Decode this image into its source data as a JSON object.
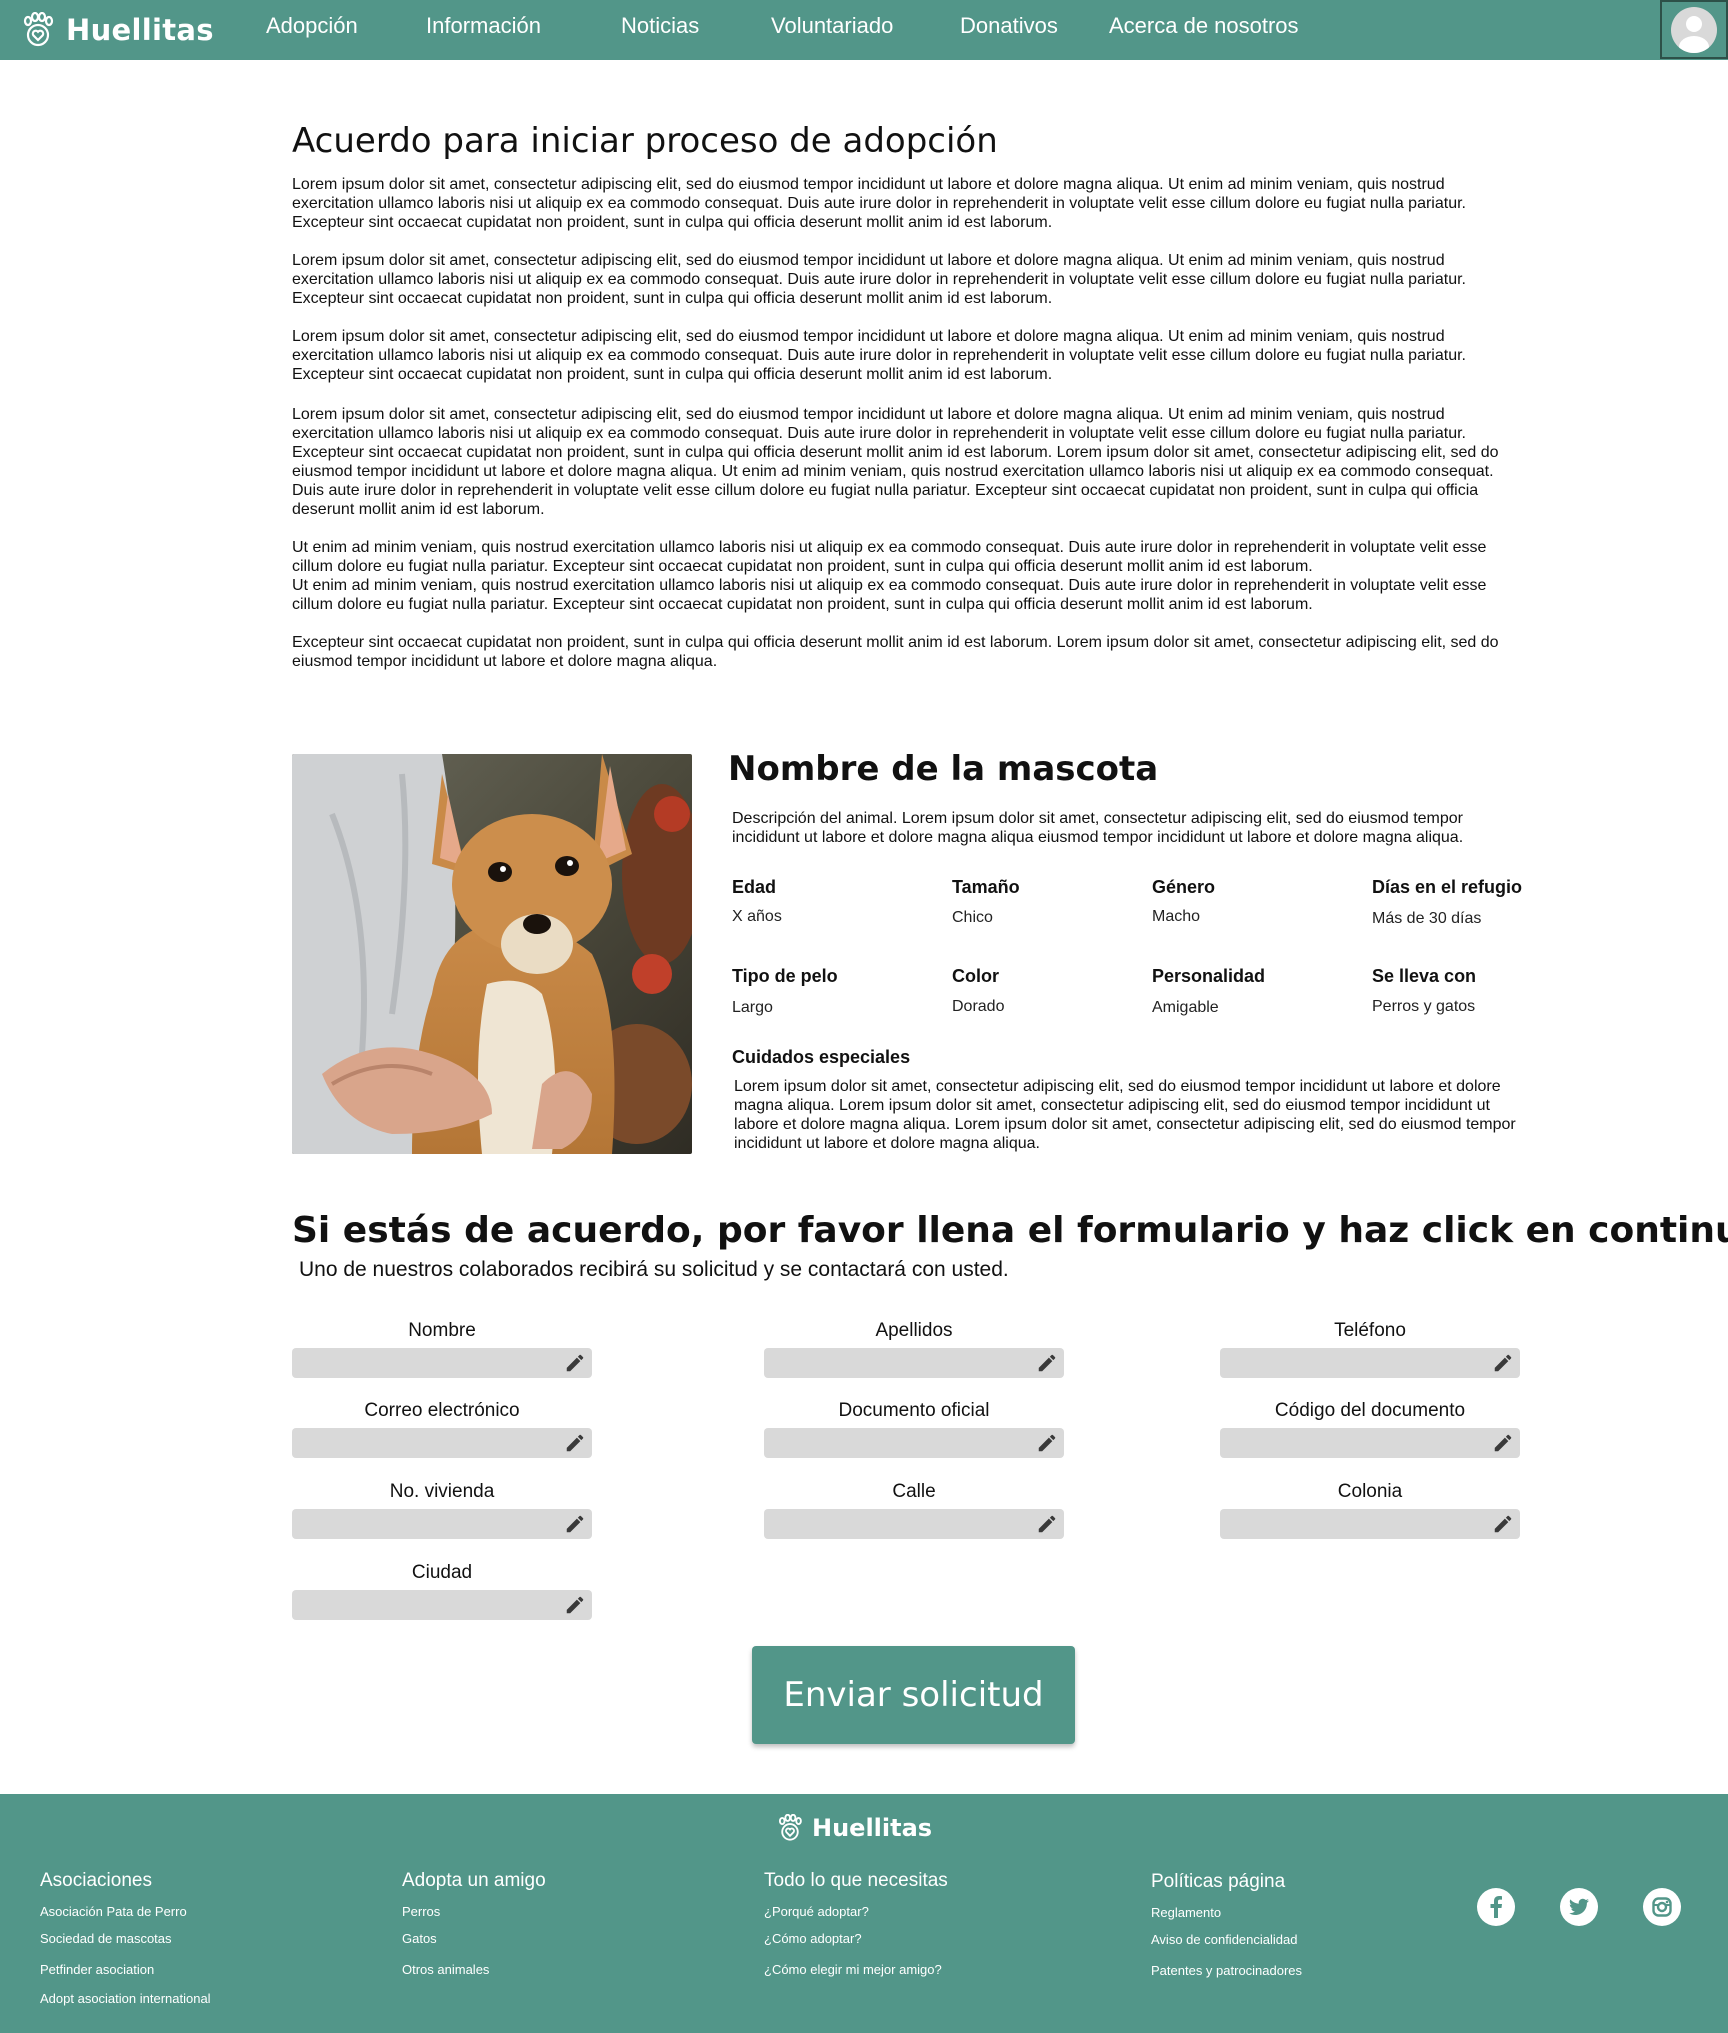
{
  "brand": {
    "name": "Huellitas"
  },
  "nav": {
    "links": [
      "Adopción",
      "Información",
      "Noticias",
      "Voluntariado",
      "Donativos",
      "Acerca de nosotros"
    ]
  },
  "agreement": {
    "title": "Acuerdo para iniciar proceso de adopción",
    "paragraphs": [
      "Lorem ipsum dolor sit amet, consectetur adipiscing elit, sed do eiusmod tempor incididunt ut labore et dolore magna aliqua. Ut enim ad minim veniam, quis nostrud exercitation ullamco laboris nisi ut aliquip ex ea commodo consequat. Duis aute irure dolor in reprehenderit in voluptate velit esse cillum dolore eu fugiat nulla pariatur. Excepteur sint occaecat cupidatat non proident, sunt in culpa qui officia deserunt mollit anim id est laborum.",
      "Lorem ipsum dolor sit amet, consectetur adipiscing elit, sed do eiusmod tempor incididunt ut labore et dolore magna aliqua. Ut enim ad minim veniam, quis nostrud exercitation ullamco laboris nisi ut aliquip ex ea commodo consequat. Duis aute irure dolor in reprehenderit in voluptate velit esse cillum dolore eu fugiat nulla pariatur. Excepteur sint occaecat cupidatat non proident, sunt in culpa qui officia deserunt mollit anim id est laborum.",
      "Lorem ipsum dolor sit amet, consectetur adipiscing elit, sed do eiusmod tempor incididunt ut labore et dolore magna aliqua. Ut enim ad minim veniam, quis nostrud exercitation ullamco laboris nisi ut aliquip ex ea commodo consequat. Duis aute irure dolor in reprehenderit in voluptate velit esse cillum dolore eu fugiat nulla pariatur. Excepteur sint occaecat cupidatat non proident, sunt in culpa qui officia deserunt mollit anim id est laborum.",
      "Lorem ipsum dolor sit amet, consectetur adipiscing elit, sed do eiusmod tempor incididunt ut labore et dolore magna aliqua. Ut enim ad minim veniam, quis nostrud exercitation ullamco laboris nisi ut aliquip ex ea commodo consequat. Duis aute irure dolor in reprehenderit in voluptate velit esse cillum dolore eu fugiat nulla pariatur. Excepteur sint occaecat cupidatat non proident, sunt in culpa qui officia deserunt mollit anim id est laborum. Lorem ipsum dolor sit amet, consectetur adipiscing elit, sed do eiusmod tempor incididunt ut labore et dolore magna aliqua. Ut enim ad minim veniam, quis nostrud exercitation ullamco laboris nisi ut aliquip ex ea commodo consequat. Duis aute irure dolor in reprehenderit in voluptate velit esse cillum dolore eu fugiat nulla pariatur. Excepteur sint occaecat cupidatat non proident, sunt in culpa qui officia deserunt mollit anim id est laborum.",
      "Ut enim ad minim veniam, quis nostrud exercitation ullamco laboris nisi ut aliquip ex ea commodo consequat. Duis aute irure dolor in reprehenderit in voluptate velit esse cillum dolore eu fugiat nulla pariatur. Excepteur sint occaecat cupidatat non proident, sunt in culpa qui officia deserunt mollit anim id est laborum.",
      "Ut enim ad minim veniam, quis nostrud exercitation ullamco laboris nisi ut aliquip ex ea commodo consequat. Duis aute irure dolor in reprehenderit in voluptate velit esse cillum dolore eu fugiat nulla pariatur. Excepteur sint occaecat cupidatat non proident, sunt in culpa qui officia deserunt mollit anim id est laborum.",
      "Excepteur sint occaecat cupidatat non proident, sunt in culpa qui officia deserunt mollit anim id est laborum. Lorem ipsum dolor sit amet, consectetur adipiscing elit, sed do eiusmod tempor incididunt ut labore et dolore magna aliqua."
    ]
  },
  "pet": {
    "name": "Nombre de la mascota",
    "description": "Descripción del animal. Lorem ipsum dolor sit amet, consectetur adipiscing elit, sed do eiusmod tempor incididunt ut labore et dolore magna aliqua eiusmod tempor incididunt ut labore et dolore magna aliqua.",
    "attributes": [
      {
        "label": "Edad",
        "value": "X años"
      },
      {
        "label": "Tamaño",
        "value": "Chico"
      },
      {
        "label": "Género",
        "value": "Macho"
      },
      {
        "label": "Días en el refugio",
        "value": "Más de 30 días"
      },
      {
        "label": "Tipo de pelo",
        "value": "Largo"
      },
      {
        "label": "Color",
        "value": "Dorado"
      },
      {
        "label": "Personalidad",
        "value": "Amigable"
      },
      {
        "label": "Se lleva con",
        "value": "Perros y gatos"
      }
    ],
    "care_label": "Cuidados especiales",
    "care_text": "Lorem ipsum dolor sit amet, consectetur adipiscing elit, sed do eiusmod tempor incididunt ut labore et dolore magna aliqua. Lorem ipsum dolor sit amet, consectetur adipiscing elit, sed do eiusmod tempor incididunt ut labore et dolore magna aliqua. Lorem ipsum dolor sit amet, consectetur adipiscing elit, sed do eiusmod tempor incididunt ut labore et dolore magna aliqua."
  },
  "form": {
    "title": "Si estás de acuerdo, por favor llena el formulario y haz click en continuar",
    "subtitle": "Uno de nuestros colaborados recibirá su solicitud y se contactará con usted.",
    "fields": [
      {
        "label": "Nombre",
        "value": ""
      },
      {
        "label": "Apellidos",
        "value": ""
      },
      {
        "label": "Teléfono",
        "value": ""
      },
      {
        "label": "Correo electrónico",
        "value": ""
      },
      {
        "label": "Documento oficial",
        "value": ""
      },
      {
        "label": "Código del documento",
        "value": ""
      },
      {
        "label": "No. vivienda",
        "value": ""
      },
      {
        "label": "Calle",
        "value": ""
      },
      {
        "label": "Colonia",
        "value": ""
      },
      {
        "label": "Ciudad",
        "value": ""
      }
    ],
    "submit_label": "Enviar solicitud"
  },
  "footer": {
    "columns": [
      {
        "heading": "Asociaciones",
        "links": [
          "Asociación Pata de Perro",
          "Sociedad de mascotas",
          "Petfinder asociation",
          "Adopt asociation international"
        ]
      },
      {
        "heading": "Adopta un amigo",
        "links": [
          "Perros",
          "Gatos",
          "Otros animales"
        ]
      },
      {
        "heading": "Todo lo que necesitas",
        "links": [
          "¿Porqué adoptar?",
          "¿Cómo adoptar?",
          "¿Cómo elegir mi mejor amigo?"
        ]
      },
      {
        "heading": "Políticas página",
        "links": [
          "Reglamento",
          "Aviso de confidencialidad",
          "Patentes y patrocinadores"
        ]
      }
    ],
    "social": [
      "facebook-icon",
      "twitter-icon",
      "instagram-icon"
    ]
  },
  "colors": {
    "brand": "#529689",
    "input_bg": "#d9d9d9"
  }
}
